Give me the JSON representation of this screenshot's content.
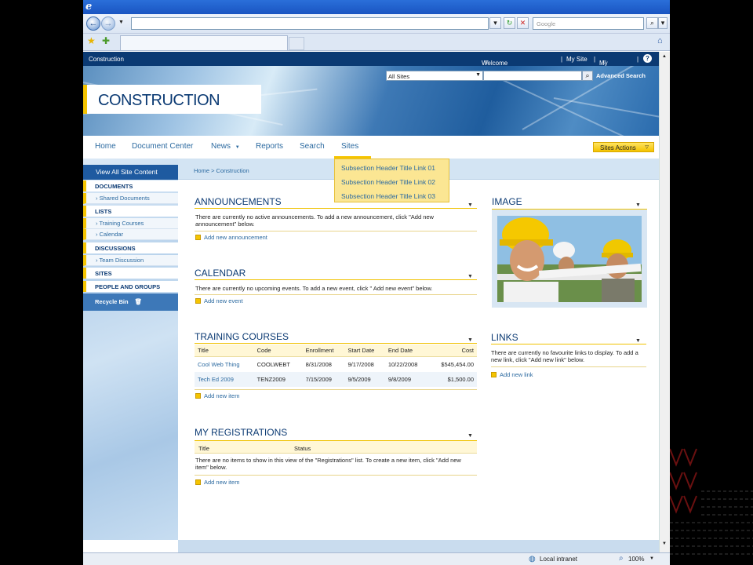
{
  "browser": {
    "search_placeholder": "Google",
    "status_zone": "Local intranet",
    "zoom": "100%"
  },
  "site": {
    "breadcrumb_title": "Construction",
    "welcome": "Welcome Administrator",
    "my_site": "My Site",
    "my_links": "My Links",
    "scope": "All Sites",
    "advanced_search": "Advanced Search",
    "logo": "CONSTRUCTION"
  },
  "nav": {
    "items": [
      "Home",
      "Document Center",
      "News",
      "Reports",
      "Search",
      "Sites"
    ],
    "sites_actions": "Sites Actions",
    "dropdown": [
      "Subsection Header Title Link 01",
      "Subsection Header Title Link 02",
      "Subsection Header Title Link 03"
    ]
  },
  "breadcrumb": "Home > Construction",
  "leftnav": {
    "view_all": "View All Site Content",
    "documents": "DOCUMENTS",
    "shared_documents": "Shared Documents",
    "lists": "LISTS",
    "training_courses": "Training Courses",
    "calendar": "Calendar",
    "discussions": "DISCUSSIONS",
    "team_discussion": "Team Discussion",
    "sites": "SITES",
    "people": "PEOPLE AND GROUPS",
    "recycle": "Recycle Bin"
  },
  "announcements": {
    "title": "ANNOUNCEMENTS",
    "text": "There are currently no active announcements. To add a new announcement, click \"Add new announcement\" below.",
    "add": "Add new announcement"
  },
  "calendar": {
    "title": "CALENDAR",
    "text": "There are currently no upcoming events. To add a new event, click \" Add new event\" below.",
    "add": "Add new event"
  },
  "training": {
    "title": "TRAINING COURSES",
    "columns": [
      "Title",
      "Code",
      "Enrollment",
      "Start Date",
      "End Date",
      "Cost"
    ],
    "rows": [
      [
        "Cool Web Thing",
        "COOLWEBT",
        "8/31/2008",
        "9/17/2008",
        "10/22/2008",
        "$545,454.00"
      ],
      [
        "Tech Ed 2009",
        "TENZ2009",
        "7/15/2009",
        "9/5/2009",
        "9/8/2009",
        "$1,500.00"
      ]
    ],
    "add": "Add new item"
  },
  "registrations": {
    "title": "MY REGISTRATIONS",
    "columns": [
      "Title",
      "Status"
    ],
    "text": "There are no items to show in this view of the \"Registrations\" list. To create a new item, click \"Add new item\" below.",
    "add": "Add new item"
  },
  "image": {
    "title": "IMAGE"
  },
  "links": {
    "title": "LINKS",
    "text": "There are currently no favourite links to display. To add a new link, click \"Add new link\" below.",
    "add": "Add new link"
  }
}
